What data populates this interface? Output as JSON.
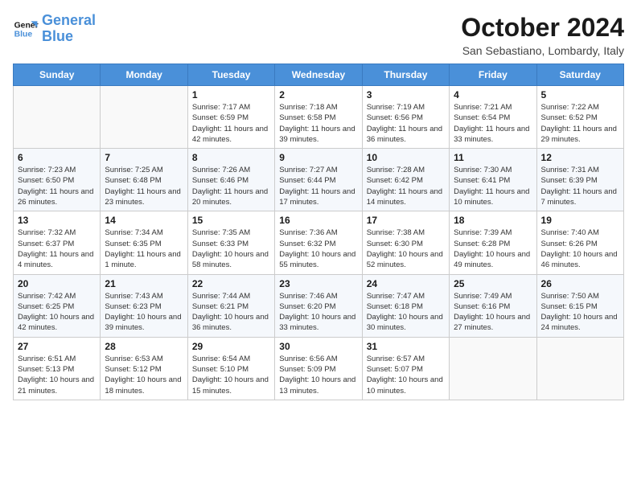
{
  "header": {
    "logo_line1": "General",
    "logo_line2": "Blue",
    "month": "October 2024",
    "location": "San Sebastiano, Lombardy, Italy"
  },
  "days_of_week": [
    "Sunday",
    "Monday",
    "Tuesday",
    "Wednesday",
    "Thursday",
    "Friday",
    "Saturday"
  ],
  "weeks": [
    [
      {
        "day": "",
        "info": ""
      },
      {
        "day": "",
        "info": ""
      },
      {
        "day": "1",
        "info": "Sunrise: 7:17 AM\nSunset: 6:59 PM\nDaylight: 11 hours and 42 minutes."
      },
      {
        "day": "2",
        "info": "Sunrise: 7:18 AM\nSunset: 6:58 PM\nDaylight: 11 hours and 39 minutes."
      },
      {
        "day": "3",
        "info": "Sunrise: 7:19 AM\nSunset: 6:56 PM\nDaylight: 11 hours and 36 minutes."
      },
      {
        "day": "4",
        "info": "Sunrise: 7:21 AM\nSunset: 6:54 PM\nDaylight: 11 hours and 33 minutes."
      },
      {
        "day": "5",
        "info": "Sunrise: 7:22 AM\nSunset: 6:52 PM\nDaylight: 11 hours and 29 minutes."
      }
    ],
    [
      {
        "day": "6",
        "info": "Sunrise: 7:23 AM\nSunset: 6:50 PM\nDaylight: 11 hours and 26 minutes."
      },
      {
        "day": "7",
        "info": "Sunrise: 7:25 AM\nSunset: 6:48 PM\nDaylight: 11 hours and 23 minutes."
      },
      {
        "day": "8",
        "info": "Sunrise: 7:26 AM\nSunset: 6:46 PM\nDaylight: 11 hours and 20 minutes."
      },
      {
        "day": "9",
        "info": "Sunrise: 7:27 AM\nSunset: 6:44 PM\nDaylight: 11 hours and 17 minutes."
      },
      {
        "day": "10",
        "info": "Sunrise: 7:28 AM\nSunset: 6:42 PM\nDaylight: 11 hours and 14 minutes."
      },
      {
        "day": "11",
        "info": "Sunrise: 7:30 AM\nSunset: 6:41 PM\nDaylight: 11 hours and 10 minutes."
      },
      {
        "day": "12",
        "info": "Sunrise: 7:31 AM\nSunset: 6:39 PM\nDaylight: 11 hours and 7 minutes."
      }
    ],
    [
      {
        "day": "13",
        "info": "Sunrise: 7:32 AM\nSunset: 6:37 PM\nDaylight: 11 hours and 4 minutes."
      },
      {
        "day": "14",
        "info": "Sunrise: 7:34 AM\nSunset: 6:35 PM\nDaylight: 11 hours and 1 minute."
      },
      {
        "day": "15",
        "info": "Sunrise: 7:35 AM\nSunset: 6:33 PM\nDaylight: 10 hours and 58 minutes."
      },
      {
        "day": "16",
        "info": "Sunrise: 7:36 AM\nSunset: 6:32 PM\nDaylight: 10 hours and 55 minutes."
      },
      {
        "day": "17",
        "info": "Sunrise: 7:38 AM\nSunset: 6:30 PM\nDaylight: 10 hours and 52 minutes."
      },
      {
        "day": "18",
        "info": "Sunrise: 7:39 AM\nSunset: 6:28 PM\nDaylight: 10 hours and 49 minutes."
      },
      {
        "day": "19",
        "info": "Sunrise: 7:40 AM\nSunset: 6:26 PM\nDaylight: 10 hours and 46 minutes."
      }
    ],
    [
      {
        "day": "20",
        "info": "Sunrise: 7:42 AM\nSunset: 6:25 PM\nDaylight: 10 hours and 42 minutes."
      },
      {
        "day": "21",
        "info": "Sunrise: 7:43 AM\nSunset: 6:23 PM\nDaylight: 10 hours and 39 minutes."
      },
      {
        "day": "22",
        "info": "Sunrise: 7:44 AM\nSunset: 6:21 PM\nDaylight: 10 hours and 36 minutes."
      },
      {
        "day": "23",
        "info": "Sunrise: 7:46 AM\nSunset: 6:20 PM\nDaylight: 10 hours and 33 minutes."
      },
      {
        "day": "24",
        "info": "Sunrise: 7:47 AM\nSunset: 6:18 PM\nDaylight: 10 hours and 30 minutes."
      },
      {
        "day": "25",
        "info": "Sunrise: 7:49 AM\nSunset: 6:16 PM\nDaylight: 10 hours and 27 minutes."
      },
      {
        "day": "26",
        "info": "Sunrise: 7:50 AM\nSunset: 6:15 PM\nDaylight: 10 hours and 24 minutes."
      }
    ],
    [
      {
        "day": "27",
        "info": "Sunrise: 6:51 AM\nSunset: 5:13 PM\nDaylight: 10 hours and 21 minutes."
      },
      {
        "day": "28",
        "info": "Sunrise: 6:53 AM\nSunset: 5:12 PM\nDaylight: 10 hours and 18 minutes."
      },
      {
        "day": "29",
        "info": "Sunrise: 6:54 AM\nSunset: 5:10 PM\nDaylight: 10 hours and 15 minutes."
      },
      {
        "day": "30",
        "info": "Sunrise: 6:56 AM\nSunset: 5:09 PM\nDaylight: 10 hours and 13 minutes."
      },
      {
        "day": "31",
        "info": "Sunrise: 6:57 AM\nSunset: 5:07 PM\nDaylight: 10 hours and 10 minutes."
      },
      {
        "day": "",
        "info": ""
      },
      {
        "day": "",
        "info": ""
      }
    ]
  ]
}
